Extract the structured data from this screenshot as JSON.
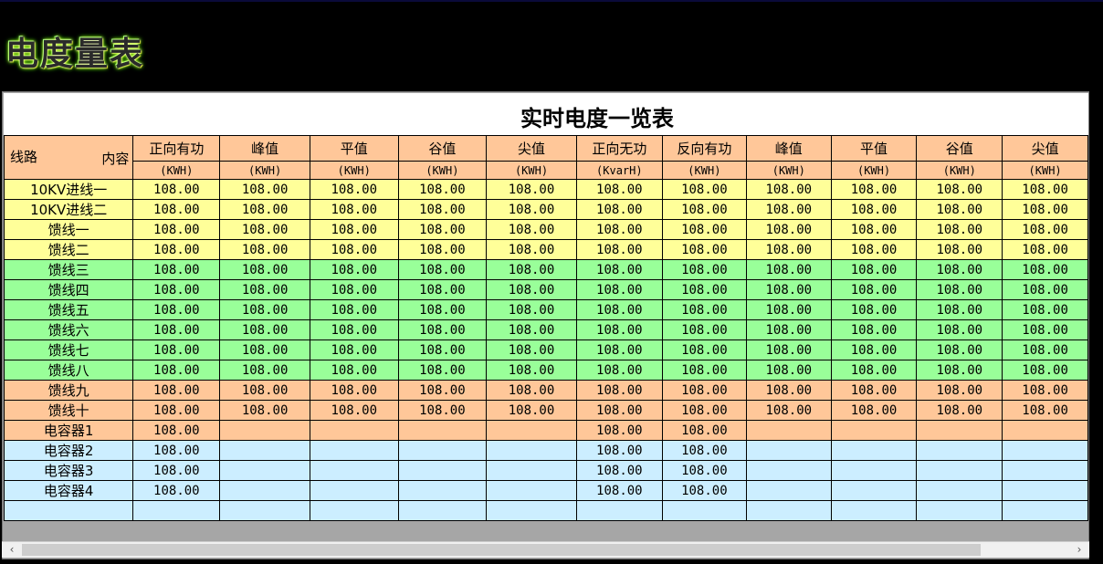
{
  "logo": {
    "text": "电度量表"
  },
  "title": "实时电度一览表",
  "header": {
    "corner_left": "线路",
    "corner_right": "内容",
    "columns": [
      "正向有功",
      "峰值",
      "平值",
      "谷值",
      "尖值",
      "正向无功",
      "反向有功",
      "峰值",
      "平值",
      "谷值",
      "尖值"
    ],
    "units": [
      "(KWH)",
      "(KWH)",
      "(KWH)",
      "(KWH)",
      "(KWH)",
      "(KvarH)",
      "(KWH)",
      "(KWH)",
      "(KWH)",
      "(KWH)",
      "(KWH)"
    ]
  },
  "rows": [
    {
      "name": "10KV进线一",
      "color": "#ffff99",
      "values": [
        "108.00",
        "108.00",
        "108.00",
        "108.00",
        "108.00",
        "108.00",
        "108.00",
        "108.00",
        "108.00",
        "108.00",
        "108.00"
      ]
    },
    {
      "name": "10KV进线二",
      "color": "#ffff99",
      "values": [
        "108.00",
        "108.00",
        "108.00",
        "108.00",
        "108.00",
        "108.00",
        "108.00",
        "108.00",
        "108.00",
        "108.00",
        "108.00"
      ]
    },
    {
      "name": "馈线一",
      "color": "#ffff99",
      "values": [
        "108.00",
        "108.00",
        "108.00",
        "108.00",
        "108.00",
        "108.00",
        "108.00",
        "108.00",
        "108.00",
        "108.00",
        "108.00"
      ]
    },
    {
      "name": "馈线二",
      "color": "#ffff99",
      "values": [
        "108.00",
        "108.00",
        "108.00",
        "108.00",
        "108.00",
        "108.00",
        "108.00",
        "108.00",
        "108.00",
        "108.00",
        "108.00"
      ]
    },
    {
      "name": "馈线三",
      "color": "#99ff99",
      "values": [
        "108.00",
        "108.00",
        "108.00",
        "108.00",
        "108.00",
        "108.00",
        "108.00",
        "108.00",
        "108.00",
        "108.00",
        "108.00"
      ]
    },
    {
      "name": "馈线四",
      "color": "#99ff99",
      "values": [
        "108.00",
        "108.00",
        "108.00",
        "108.00",
        "108.00",
        "108.00",
        "108.00",
        "108.00",
        "108.00",
        "108.00",
        "108.00"
      ]
    },
    {
      "name": "馈线五",
      "color": "#99ff99",
      "values": [
        "108.00",
        "108.00",
        "108.00",
        "108.00",
        "108.00",
        "108.00",
        "108.00",
        "108.00",
        "108.00",
        "108.00",
        "108.00"
      ]
    },
    {
      "name": "馈线六",
      "color": "#99ff99",
      "values": [
        "108.00",
        "108.00",
        "108.00",
        "108.00",
        "108.00",
        "108.00",
        "108.00",
        "108.00",
        "108.00",
        "108.00",
        "108.00"
      ]
    },
    {
      "name": "馈线七",
      "color": "#99ff99",
      "values": [
        "108.00",
        "108.00",
        "108.00",
        "108.00",
        "108.00",
        "108.00",
        "108.00",
        "108.00",
        "108.00",
        "108.00",
        "108.00"
      ]
    },
    {
      "name": "馈线八",
      "color": "#99ff99",
      "values": [
        "108.00",
        "108.00",
        "108.00",
        "108.00",
        "108.00",
        "108.00",
        "108.00",
        "108.00",
        "108.00",
        "108.00",
        "108.00"
      ]
    },
    {
      "name": "馈线九",
      "color": "#ffc799",
      "values": [
        "108.00",
        "108.00",
        "108.00",
        "108.00",
        "108.00",
        "108.00",
        "108.00",
        "108.00",
        "108.00",
        "108.00",
        "108.00"
      ]
    },
    {
      "name": "馈线十",
      "color": "#ffc799",
      "values": [
        "108.00",
        "108.00",
        "108.00",
        "108.00",
        "108.00",
        "108.00",
        "108.00",
        "108.00",
        "108.00",
        "108.00",
        "108.00"
      ]
    },
    {
      "name": "电容器1",
      "color": "#ffc799",
      "values": [
        "108.00",
        "",
        "",
        "",
        "",
        "108.00",
        "108.00",
        "",
        "",
        "",
        ""
      ]
    },
    {
      "name": "电容器2",
      "color": "#cceeff",
      "values": [
        "108.00",
        "",
        "",
        "",
        "",
        "108.00",
        "108.00",
        "",
        "",
        "",
        ""
      ]
    },
    {
      "name": "电容器3",
      "color": "#cceeff",
      "values": [
        "108.00",
        "",
        "",
        "",
        "",
        "108.00",
        "108.00",
        "",
        "",
        "",
        ""
      ]
    },
    {
      "name": "电容器4",
      "color": "#cceeff",
      "values": [
        "108.00",
        "",
        "",
        "",
        "",
        "108.00",
        "108.00",
        "",
        "",
        "",
        ""
      ]
    },
    {
      "name": "",
      "color": "#cceeff",
      "values": [
        "",
        "",
        "",
        "",
        "",
        "",
        "",
        "",
        "",
        "",
        ""
      ]
    }
  ],
  "scrollbar": {
    "left_arrow": "‹",
    "right_arrow": "›"
  }
}
